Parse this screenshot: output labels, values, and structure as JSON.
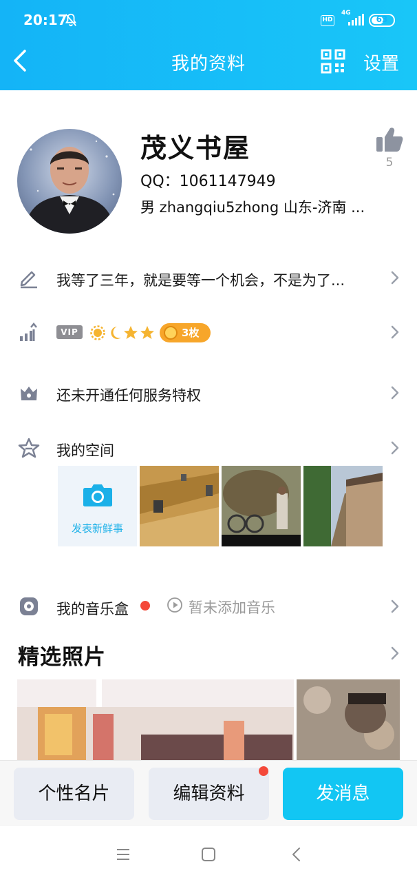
{
  "status": {
    "time": "20:17",
    "network": "4G",
    "hd": "HD",
    "battery": "63",
    "battery_level": 0.63
  },
  "header": {
    "title": "我的资料",
    "settings_label": "设置",
    "back_icon": "chevron-left-icon",
    "qr_icon": "qr-code-icon"
  },
  "profile": {
    "name": "茂义书屋",
    "qq": "QQ：1061147949",
    "info": "男  zhangqiu5zhong  山东-济南 ...",
    "likes": "5"
  },
  "rows": {
    "signature": "我等了三年，就是要等一个机会，不是为了...",
    "vip_badge": "VIP",
    "badge_count": "3枚",
    "privileges": "还未开通任何服务特权",
    "space": "我的空间",
    "post_label": "发表新鲜事",
    "music": "我的音乐盒",
    "music_status": "暂未添加音乐"
  },
  "photos_section": {
    "title": "精选照片"
  },
  "actions": {
    "card": "个性名片",
    "edit": "编辑资料",
    "message": "发消息"
  },
  "colors": {
    "header_blue": "#14b4f7",
    "accent": "#12c6f3",
    "notification_dot": "#f4493a",
    "badge_orange": "#f7a62a"
  }
}
